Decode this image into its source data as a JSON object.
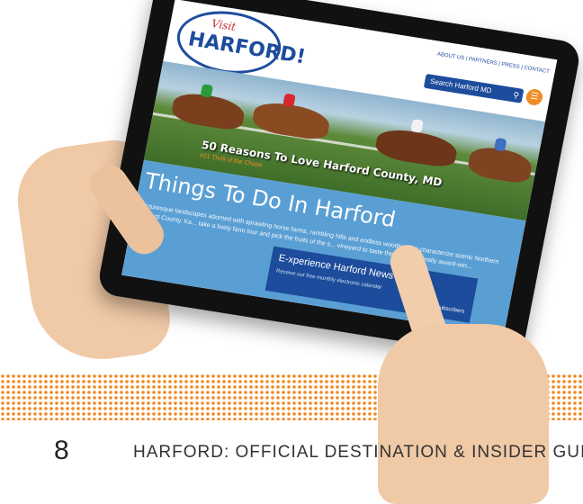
{
  "site": {
    "logo_small": "Visit",
    "logo_main": "HARFORD!",
    "nav_links": "ABOUT US | PARTNERS | PRESS | CONTACT",
    "search_placeholder": "Search Harford MD",
    "hero_title": "50 Reasons To Love Harford County, MD",
    "hero_subtitle": "#21 Thrill of the Chase",
    "section_title": "Things To Do In Harford",
    "section_text": "Picturesque landscapes adorned with sprawling horse farms, rambling hills and endless woodscapes characterize scenic Northern Harford County. Ka... take a lively farm tour and pick the fruits of the s... vineyard to taste their internationally award-win...",
    "newsletter_title": "E-xperience Harford News",
    "newsletter_text": "Receive our free monthly electronic calendar",
    "newsletter_subscribe": "Subscribers"
  },
  "footer": {
    "page_number": "8",
    "guide_title": "HARFORD: OFFICIAL DESTINATION & INSIDER GUIDE"
  },
  "colors": {
    "brand_blue": "#1d4c9c",
    "accent_orange": "#f08a24",
    "section_blue": "#5a9fd4"
  },
  "icons": [
    "search-icon",
    "menu-icon"
  ]
}
